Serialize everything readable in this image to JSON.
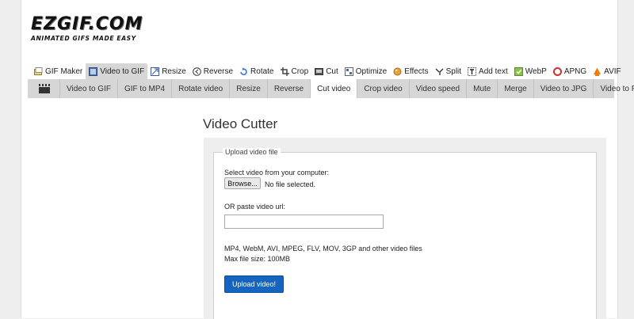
{
  "logo": {
    "text": "EZGIF.COM",
    "tagline": "ANIMATED GIFS MADE EASY"
  },
  "main_nav": [
    {
      "label": "GIF Maker",
      "icon": "gif-maker-icon"
    },
    {
      "label": "Video to GIF",
      "icon": "video-icon"
    },
    {
      "label": "Resize",
      "icon": "resize-icon"
    },
    {
      "label": "Reverse",
      "icon": "reverse-icon"
    },
    {
      "label": "Rotate",
      "icon": "rotate-icon"
    },
    {
      "label": "Crop",
      "icon": "crop-icon"
    },
    {
      "label": "Cut",
      "icon": "cut-icon"
    },
    {
      "label": "Optimize",
      "icon": "optimize-icon"
    },
    {
      "label": "Effects",
      "icon": "effects-icon"
    },
    {
      "label": "Split",
      "icon": "split-icon"
    },
    {
      "label": "Add text",
      "icon": "add-text-icon"
    },
    {
      "label": "WebP",
      "icon": "webp-icon"
    },
    {
      "label": "APNG",
      "icon": "apng-icon"
    },
    {
      "label": "AVIF",
      "icon": "avif-icon"
    }
  ],
  "main_nav_active": "Video to GIF",
  "sub_nav": [
    "Video to GIF",
    "GIF to MP4",
    "Rotate video",
    "Resize",
    "Reverse",
    "Cut video",
    "Crop video",
    "Video speed",
    "Mute",
    "Merge",
    "Video to JPG",
    "Video to PNG"
  ],
  "sub_nav_active": "Cut video",
  "page_title": "Video Cutter",
  "form": {
    "legend": "Upload video file",
    "select_label": "Select video from your computer:",
    "browse_label": "Browse...",
    "no_file": "No file selected.",
    "url_label": "OR paste video url:",
    "url_value": "",
    "formats": "MP4, WebM, AVI, MPEG, FLV, MOV, 3GP and other video files",
    "max_size": "Max file size: 100MB",
    "upload_label": "Upload video!"
  }
}
